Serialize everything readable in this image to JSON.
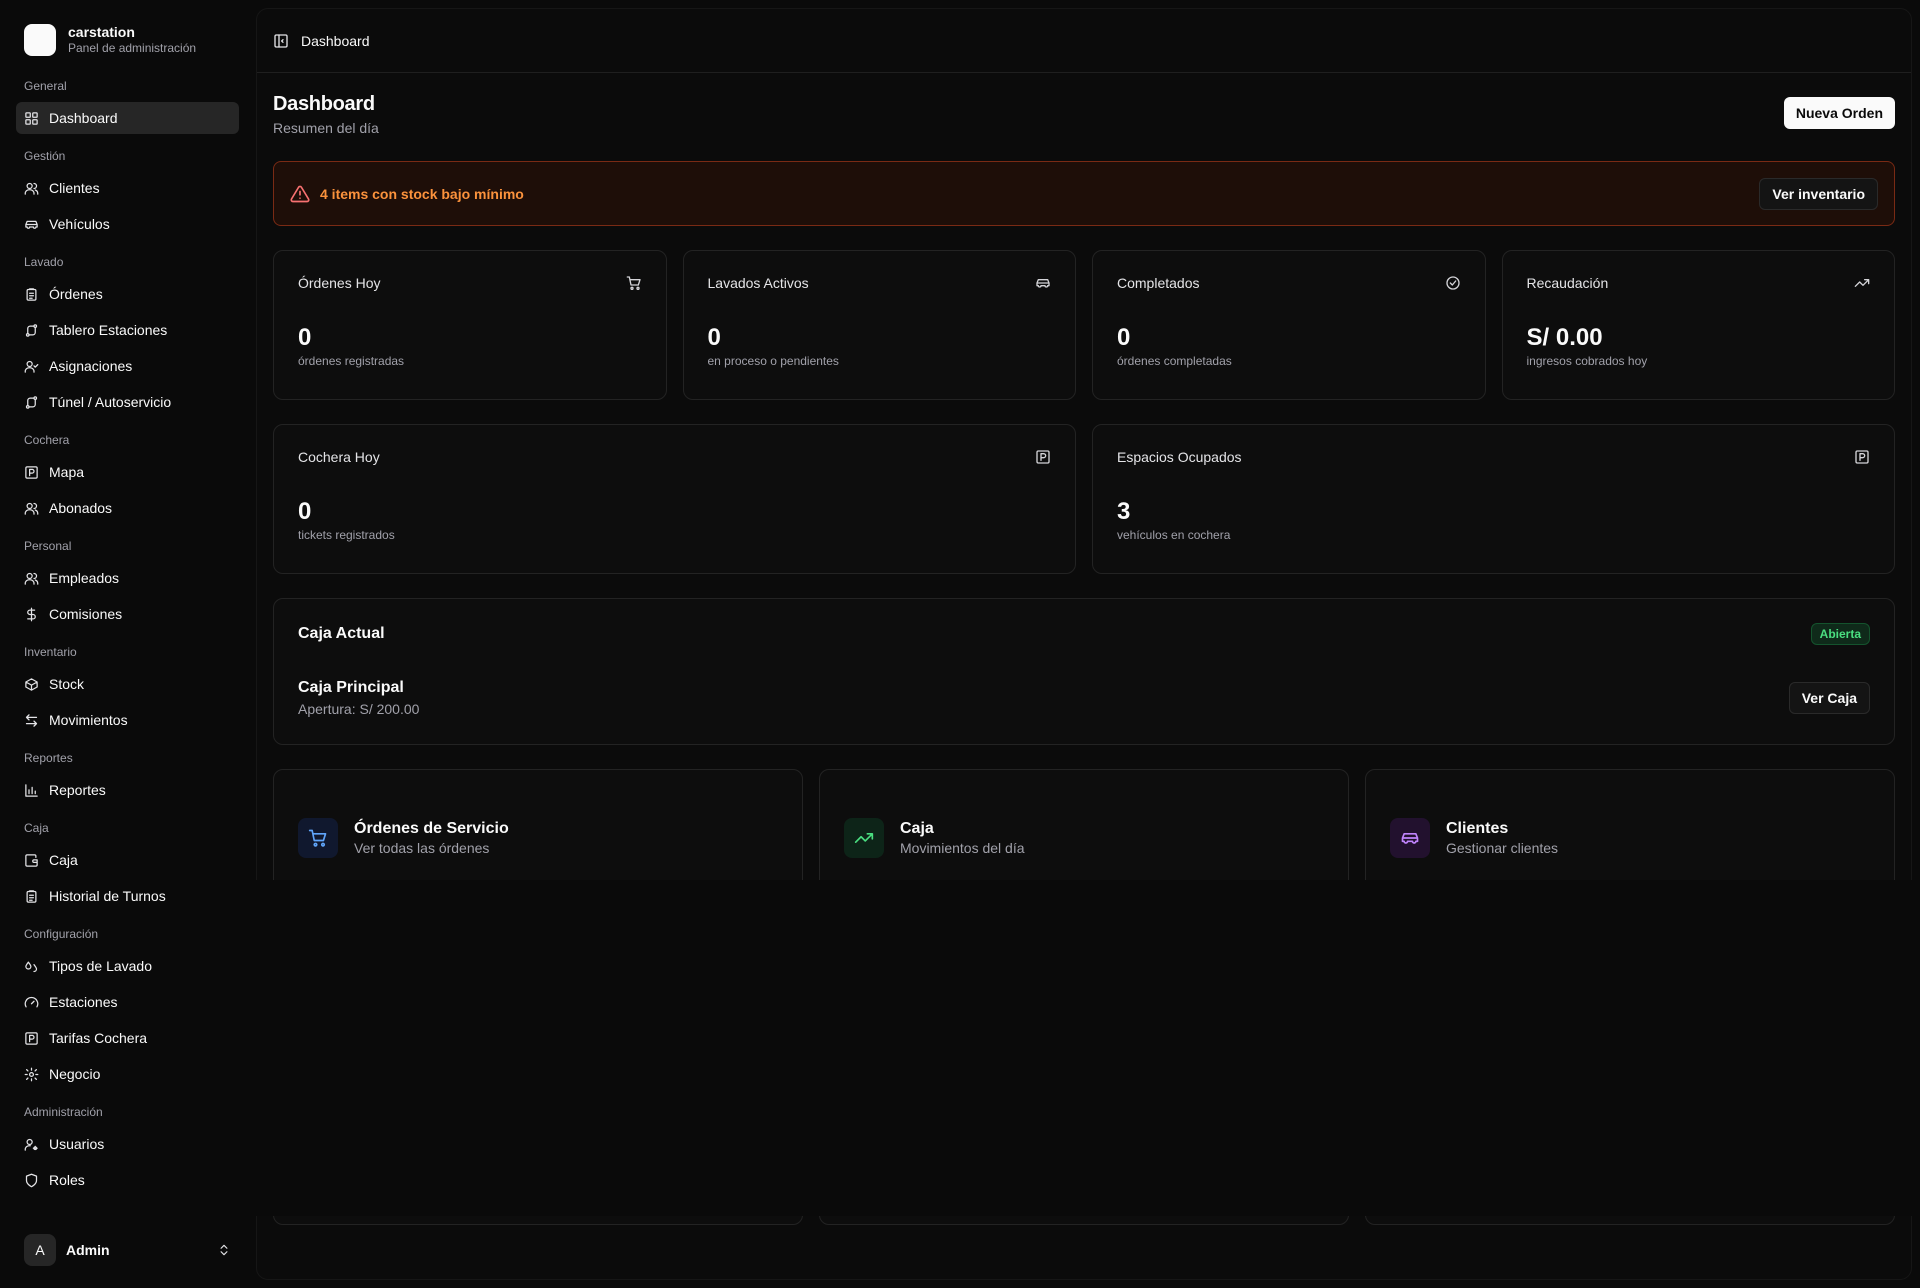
{
  "brand": {
    "name": "carstation",
    "subtitle": "Panel de administración"
  },
  "nav": [
    {
      "label": "General",
      "items": [
        {
          "label": "Dashboard",
          "icon": "dashboard-icon",
          "active": true
        }
      ]
    },
    {
      "label": "Gestión",
      "items": [
        {
          "label": "Clientes",
          "icon": "users-icon"
        },
        {
          "label": "Vehículos",
          "icon": "car-icon"
        }
      ]
    },
    {
      "label": "Lavado",
      "items": [
        {
          "label": "Órdenes",
          "icon": "clipboard-icon"
        },
        {
          "label": "Tablero Estaciones",
          "icon": "route-icon"
        },
        {
          "label": "Asignaciones",
          "icon": "user-check-icon"
        },
        {
          "label": "Túnel / Autoservicio",
          "icon": "route-icon"
        }
      ]
    },
    {
      "label": "Cochera",
      "items": [
        {
          "label": "Mapa",
          "icon": "parking-icon"
        },
        {
          "label": "Abonados",
          "icon": "users-icon"
        }
      ]
    },
    {
      "label": "Personal",
      "items": [
        {
          "label": "Empleados",
          "icon": "users-icon"
        },
        {
          "label": "Comisiones",
          "icon": "dollar-icon"
        }
      ]
    },
    {
      "label": "Inventario",
      "items": [
        {
          "label": "Stock",
          "icon": "package-icon"
        },
        {
          "label": "Movimientos",
          "icon": "arrows-icon"
        }
      ]
    },
    {
      "label": "Reportes",
      "items": [
        {
          "label": "Reportes",
          "icon": "bar-chart-icon"
        }
      ]
    },
    {
      "label": "Caja",
      "items": [
        {
          "label": "Caja",
          "icon": "wallet-icon"
        },
        {
          "label": "Historial de Turnos",
          "icon": "clipboard-icon"
        }
      ]
    },
    {
      "label": "Configuración",
      "items": [
        {
          "label": "Tipos de Lavado",
          "icon": "droplets-icon"
        },
        {
          "label": "Estaciones",
          "icon": "gauge-icon"
        },
        {
          "label": "Tarifas Cochera",
          "icon": "parking-icon"
        },
        {
          "label": "Negocio",
          "icon": "gear-icon"
        }
      ]
    },
    {
      "label": "Administración",
      "items": [
        {
          "label": "Usuarios",
          "icon": "user-cog-icon"
        },
        {
          "label": "Roles",
          "icon": "shield-icon"
        }
      ]
    }
  ],
  "user": {
    "initial": "A",
    "name": "Admin"
  },
  "topbar": {
    "breadcrumb": "Dashboard"
  },
  "page": {
    "title": "Dashboard",
    "subtitle": "Resumen del día",
    "primary_button": "Nueva Orden"
  },
  "alert": {
    "text": "4 items con stock bajo mínimo",
    "button": "Ver inventario"
  },
  "stats": [
    {
      "title": "Órdenes Hoy",
      "value": "0",
      "desc": "órdenes registradas",
      "icon": "cart-icon"
    },
    {
      "title": "Lavados Activos",
      "value": "0",
      "desc": "en proceso o pendientes",
      "icon": "car-icon"
    },
    {
      "title": "Completados",
      "value": "0",
      "desc": "órdenes completadas",
      "icon": "check-circle-icon"
    },
    {
      "title": "Recaudación",
      "value": "S/ 0.00",
      "desc": "ingresos cobrados hoy",
      "icon": "trending-up-icon"
    }
  ],
  "parking": [
    {
      "title": "Cochera Hoy",
      "value": "0",
      "desc": "tickets registrados",
      "icon": "parking-icon"
    },
    {
      "title": "Espacios Ocupados",
      "value": "3",
      "desc": "vehículos en cochera",
      "icon": "parking-icon"
    }
  ],
  "caja": {
    "title": "Caja Actual",
    "status": "Abierta",
    "name": "Caja Principal",
    "apertura": "Apertura: S/ 200.00",
    "button": "Ver Caja"
  },
  "links": [
    {
      "title": "Órdenes de Servicio",
      "subtitle": "Ver todas las órdenes",
      "icon": "cart-icon",
      "bg": "#10182e",
      "color": "#60a5fa"
    },
    {
      "title": "Caja",
      "subtitle": "Movimientos del día",
      "icon": "trending-up-icon",
      "bg": "#0d2418",
      "color": "#4ade80"
    },
    {
      "title": "Clientes",
      "subtitle": "Gestionar clientes",
      "icon": "car-icon",
      "bg": "#22112e",
      "color": "#c084fc"
    }
  ]
}
